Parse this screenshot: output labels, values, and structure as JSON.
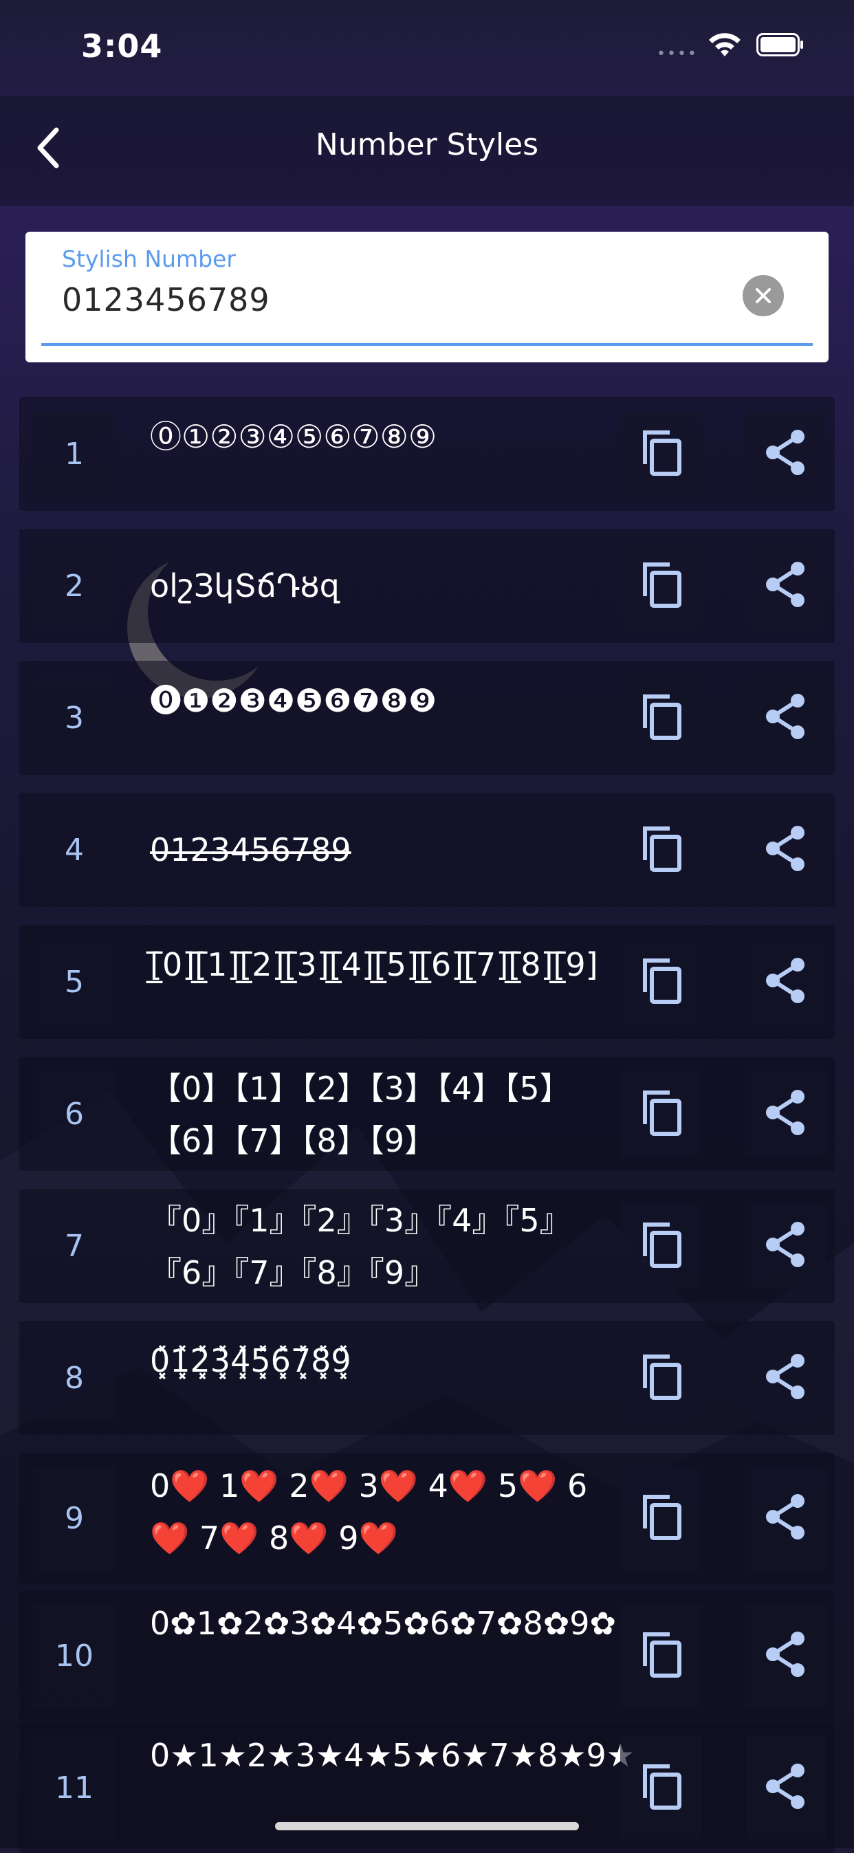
{
  "status": {
    "time": "3:04",
    "signal": "••••"
  },
  "nav": {
    "title": "Number Styles"
  },
  "input": {
    "label": "Stylish Number",
    "value": "0123456789"
  },
  "colors": {
    "accent": "#5b9bee",
    "number": "#a9c4f0",
    "icon": "#b7cdf5"
  },
  "rows": [
    {
      "num": "1",
      "text": "⓪①②③④⑤⑥⑦⑧⑨"
    },
    {
      "num": "2",
      "text": "oⅼշЗկՏճԴȣզ"
    },
    {
      "num": "3",
      "text": "⓿❶❷❸❹❺❻❼❽❾"
    },
    {
      "num": "4",
      "text": "0̶1̶2̶3̶4̶5̶6̶7̶8̶9̶"
    },
    {
      "num": "5",
      "text": "[̲̅0][̲̅1][̲̅2][̲̅3][̲̅4][̲̅5][̲̅6][̲̅7][̲̅8][̲̅9]"
    },
    {
      "num": "6",
      "text": "【0】【1】【2】【3】【4】【5】【6】【7】【8】【9】"
    },
    {
      "num": "7",
      "text": "『0』『1』『2』『3』『4』『5』『6』『7』『8』『9』"
    },
    {
      "num": "8",
      "text": "0͓̽1͓̽2͓̽3͓̽4͓̽5͓̽6͓̽7͓̽8͓̽9͓̽"
    },
    {
      "num": "9",
      "text": "0❤️ 1❤️ 2❤️ 3❤️ 4❤️ 5❤️ 6❤️ 7❤️ 8❤️ 9❤️"
    },
    {
      "num": "10",
      "text": "0✿1✿2✿3✿4✿5✿6✿7✿8✿9✿"
    },
    {
      "num": "11",
      "text": "0★1★2★3★4★5★6★7★8★9★"
    }
  ]
}
